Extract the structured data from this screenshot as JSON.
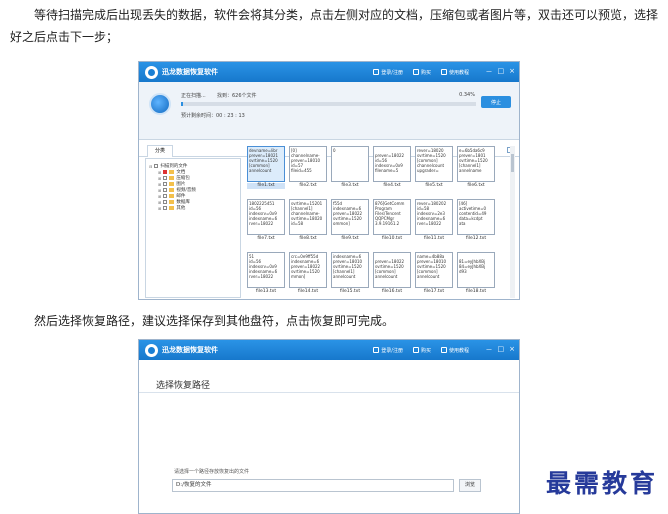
{
  "paragraphs": {
    "p1": "等待扫描完成后出现丢失的数据，软件会将其分类，点击左侧对应的文档，压缩包或者图片等，双击还可以预览，选择好之后点击下一步；",
    "p2": "然后选择恢复路径，建议选择保存到其他盘符，点击恢复即可完成。"
  },
  "app1": {
    "title": "迅龙数据恢复软件",
    "menu": [
      "登录/注册",
      "购买",
      "使用教程"
    ],
    "window_controls": [
      "－",
      "□",
      "×"
    ],
    "scan": {
      "status": "正在扫描...",
      "found": "找到：626个文件",
      "percent": "0.34%",
      "progress": 0.0034,
      "time": "预计剩余时间：00 : 23 : 13",
      "stop_label": "停止"
    },
    "tab_label": "分类",
    "tree": {
      "root": "扫描到的文件",
      "items": [
        "文档",
        "压缩包",
        "图片",
        "视频/音频",
        "邮件",
        "数据库",
        "其他"
      ]
    },
    "files": [
      {
        "name": "file1.txt",
        "text": "devname=libr\nprever=18021\nsvrtime=1520\n[common]\nannelcount\n",
        "selected": true
      },
      {
        "name": "file2.txt",
        "text": "[0]\nchannelname-\nprever=18010\nid=57\nfileid=455"
      },
      {
        "name": "file3.txt",
        "text": "0\n\n\n\n"
      },
      {
        "name": "file4.txt",
        "text": "\nprever=18022\nid=56\nindexsrv=0x9\nfilename=5"
      },
      {
        "name": "file5.txt",
        "text": "rever=18020\nsvrtime=1520\n[common]\nchannelcount\nupgrader="
      },
      {
        "name": "file6.txt",
        "text": "e=6b5da6c9\nprever=1801\nsvrtime=1520\n[channel1]\nannelname"
      },
      {
        "name": "file7.txt",
        "text": "1802225451\nid=56\nindexsrv=0x9\nindexname=6\nrver=18022"
      },
      {
        "name": "file8.txt",
        "text": "svrtime=15201\n[channel1]\nchannelname-\nsvrtime=18020\nid=58"
      },
      {
        "name": "file9.txt",
        "text": "f55d\nindexname=6\nprever=18022\nsvrtime=1520\nommon]"
      },
      {
        "name": "file10.txt",
        "text": "876]GetComm\nProgram\nFiles\\Tencent\nQQPCMgr\n3.9.19161.2"
      },
      {
        "name": "file11.txt",
        "text": "rever=180202\nid=58\nindexsrv=2e3\nindexname=6\nrver=18022"
      },
      {
        "name": "file12.txt",
        "text": "[46]\nactivetime=0\ncontentid=49\ndata=kcdpt\nata"
      },
      {
        "name": "file13.txt",
        "text": "51\nid=56\nindexsrv=0x9\nindexname=6\nrver=18022"
      },
      {
        "name": "file14.txt",
        "text": "crc=0e9ff55d\nindexname=6\nprever=18022\nsvrtime=1520\nmmon]"
      },
      {
        "name": "file15.txt",
        "text": "indexname=6\nprever=18010\nsvrtime=1520\n[channel1]\nannelcount"
      },
      {
        "name": "file16.txt",
        "text": "\nprever=18022\nsvrtime=1520\n[common]\nannelcount"
      },
      {
        "name": "file17.txt",
        "text": "name=4b88a\nprever=18010\nsvrtime=1520\n[common]\nannelcount"
      },
      {
        "name": "file18.txt",
        "text": "\n81=eyJhbXBj\n84=eyJhbXBj\nd93\n"
      }
    ]
  },
  "app2": {
    "title": "迅龙数据恢复软件",
    "menu": [
      "登录/注册",
      "购买",
      "使用教程"
    ],
    "heading": "选择恢复路径",
    "path_label": "请选择一个路径存放恢复出的文件",
    "path_value": "D:/恢复的文件",
    "browse_label": "浏览"
  },
  "watermark": "最需教育"
}
